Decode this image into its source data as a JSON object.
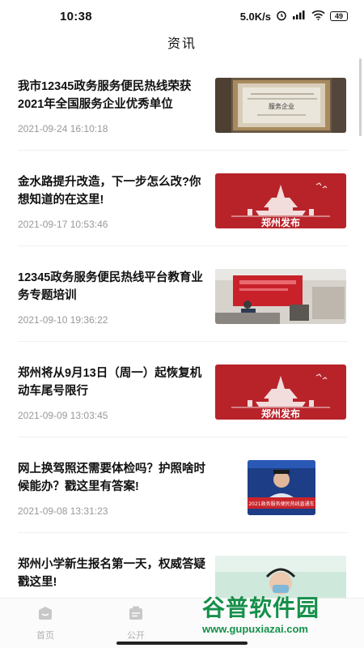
{
  "status_bar": {
    "time": "10:38",
    "net_speed": "5.0K/s",
    "battery": "49"
  },
  "header": {
    "title": "资讯"
  },
  "news": [
    {
      "title": "我市12345政务服务便民热线荣获2021年全国服务企业优秀单位",
      "date": "2021-09-24 16:10:18",
      "thumb": "award-plaque-image",
      "thumb_text": "服务企业"
    },
    {
      "title": "金水路提升改造，下一步怎么改?你想知道的在这里!",
      "date": "2021-09-17 10:53:46",
      "thumb": "zhengzhou-release-image",
      "thumb_text": "郑州发布"
    },
    {
      "title": "12345政务服务便民热线平台教育业务专题培训",
      "date": "2021-09-10 19:36:22",
      "thumb": "training-room-image"
    },
    {
      "title": "郑州将从9月13日（周一）起恢复机动车尾号限行",
      "date": "2021-09-09 13:03:45",
      "thumb": "zhengzhou-release-image",
      "thumb_text": "郑州发布"
    },
    {
      "title": "网上换驾照还需要体检吗？护照啥时候能办？戳这里有答案!",
      "date": "2021-09-08 13:31:23",
      "thumb": "police-officer-image",
      "thumb_text": "2021政务服务便民热线直通车"
    },
    {
      "title": "郑州小学新生报名第一天，权威答疑戳这里!",
      "date": "",
      "thumb": "operator-image"
    }
  ],
  "tabs": [
    {
      "label": "首页",
      "icon": "home-icon"
    },
    {
      "label": "公开",
      "icon": "notice-icon"
    }
  ],
  "watermark": {
    "title": "谷普软件园",
    "url": "www.gupuxiazai.com"
  },
  "colors": {
    "brand_red": "#b8232a",
    "watermark_green": "#15904a"
  }
}
